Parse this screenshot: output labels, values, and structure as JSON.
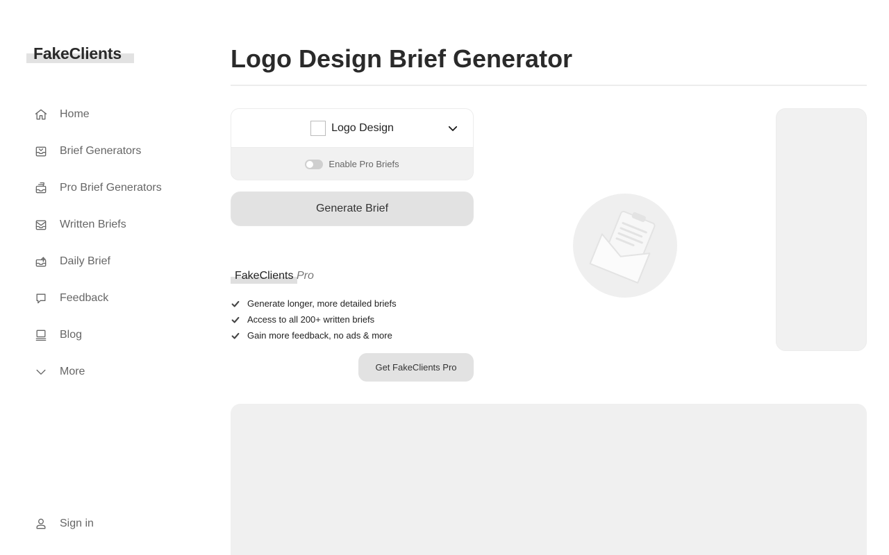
{
  "brand": {
    "name": "FakeClients"
  },
  "sidebar": {
    "items": [
      {
        "label": "Home",
        "icon": "home-icon"
      },
      {
        "label": "Brief Generators",
        "icon": "inbox-icon"
      },
      {
        "label": "Pro Brief Generators",
        "icon": "inbox-stack-icon"
      },
      {
        "label": "Written Briefs",
        "icon": "mail-icon"
      },
      {
        "label": "Daily Brief",
        "icon": "inbox-arrow-icon"
      },
      {
        "label": "Feedback",
        "icon": "chat-bubble-icon"
      },
      {
        "label": "Blog",
        "icon": "monitor-icon"
      },
      {
        "label": "More",
        "icon": "chevron-down-icon"
      }
    ],
    "signin": {
      "label": "Sign in",
      "icon": "user-icon"
    }
  },
  "main": {
    "title": "Logo Design Brief Generator",
    "generator": {
      "selected": "Logo Design",
      "pro_toggle_label": "Enable Pro Briefs",
      "generate_label": "Generate Brief"
    },
    "pro": {
      "brand": "FakeClients",
      "suffix": "Pro",
      "features": [
        "Generate longer, more detailed briefs",
        "Access to all 200+ written briefs",
        "Gain more feedback, no ads & more"
      ],
      "cta_label": "Get FakeClients Pro"
    }
  },
  "colors": {
    "accent_gray": "#e2e2e2",
    "panel_gray": "#f1f1f1",
    "text_dark": "#222222",
    "text_muted": "#666666"
  }
}
